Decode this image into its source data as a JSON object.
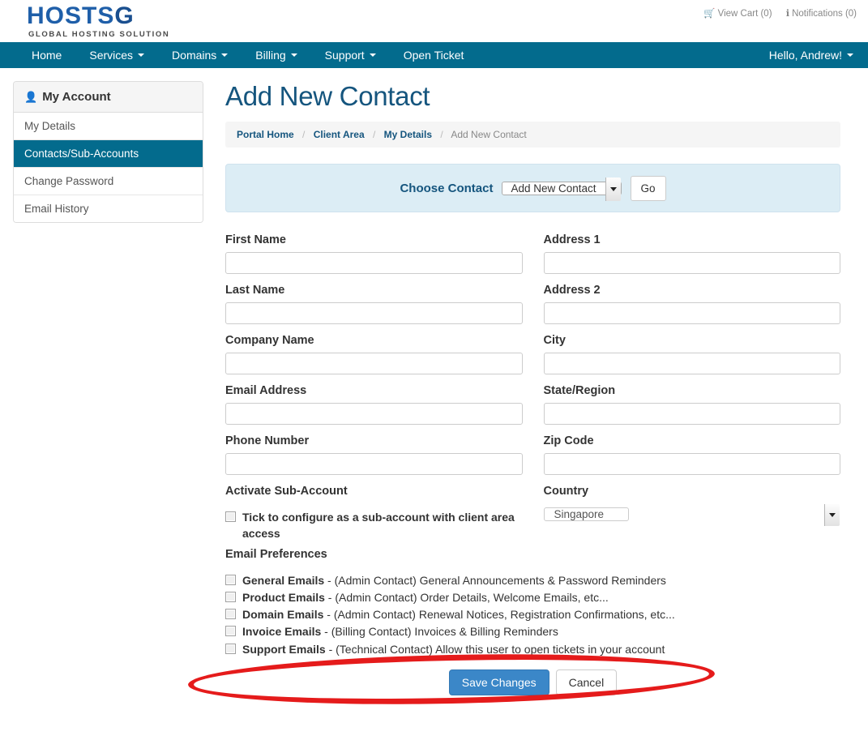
{
  "brand": {
    "logo_main": "HOSTSG",
    "logo_main_prefix": "HOSTS",
    "logo_main_accent": "G",
    "logo_sub": "GLOBAL HOSTING SOLUTION",
    "teal": "#036b8d",
    "title_blue": "#15557e",
    "primary_blue": "#3b87c8",
    "annotation_red": "#e51b1b"
  },
  "topbar": {
    "cart": "View Cart (0)",
    "cart_icon": "cart-icon",
    "notifications": "Notifications (0)",
    "notifications_icon": "info-icon"
  },
  "nav": {
    "items": [
      {
        "label": "Home",
        "has_caret": false
      },
      {
        "label": "Services",
        "has_caret": true
      },
      {
        "label": "Domains",
        "has_caret": true
      },
      {
        "label": "Billing",
        "has_caret": true
      },
      {
        "label": "Support",
        "has_caret": true
      },
      {
        "label": "Open Ticket",
        "has_caret": false
      }
    ],
    "user_greeting": "Hello, Andrew!"
  },
  "sidebar": {
    "heading": "My Account",
    "heading_icon": "user-icon",
    "items": [
      {
        "label": "My Details",
        "active": false
      },
      {
        "label": "Contacts/Sub-Accounts",
        "active": true
      },
      {
        "label": "Change Password",
        "active": false
      },
      {
        "label": "Email History",
        "active": false
      }
    ]
  },
  "main": {
    "page_title": "Add New Contact",
    "breadcrumb": [
      {
        "label": "Portal Home",
        "current": false
      },
      {
        "label": "Client Area",
        "current": false
      },
      {
        "label": "My Details",
        "current": false
      },
      {
        "label": "Add New Contact",
        "current": true
      }
    ],
    "breadcrumb_separator": "/",
    "choose_contact": {
      "label": "Choose Contact",
      "selected": "Add New Contact",
      "go_label": "Go"
    },
    "fields_left": [
      {
        "label": "First Name",
        "value": "",
        "name": "first-name"
      },
      {
        "label": "Last Name",
        "value": "",
        "name": "last-name"
      },
      {
        "label": "Company Name",
        "value": "",
        "name": "company-name"
      },
      {
        "label": "Email Address",
        "value": "",
        "name": "email-address"
      },
      {
        "label": "Phone Number",
        "value": "",
        "name": "phone-number"
      }
    ],
    "fields_right": [
      {
        "label": "Address 1",
        "value": "",
        "name": "address-1"
      },
      {
        "label": "Address 2",
        "value": "",
        "name": "address-2"
      },
      {
        "label": "City",
        "value": "",
        "name": "city"
      },
      {
        "label": "State/Region",
        "value": "",
        "name": "state-region"
      },
      {
        "label": "Zip Code",
        "value": "",
        "name": "zip-code"
      }
    ],
    "sub_account": {
      "label": "Activate Sub-Account",
      "checkbox_text": "Tick to configure as a sub-account with client area access",
      "checked": false
    },
    "country": {
      "label": "Country",
      "selected": "Singapore"
    },
    "email_preferences": {
      "label": "Email Preferences",
      "items": [
        {
          "name": "General Emails",
          "desc": " - (Admin Contact) General Announcements & Password Reminders",
          "checked": false
        },
        {
          "name": "Product Emails",
          "desc": " - (Admin Contact) Order Details, Welcome Emails, etc...",
          "checked": false
        },
        {
          "name": "Domain Emails",
          "desc": " - (Admin Contact) Renewal Notices, Registration Confirmations, etc...",
          "checked": false
        },
        {
          "name": "Invoice Emails",
          "desc": " - (Billing Contact) Invoices & Billing Reminders",
          "checked": false
        },
        {
          "name": "Support Emails",
          "desc": " - (Technical Contact) Allow this user to open tickets in your account",
          "checked": false
        }
      ]
    },
    "actions": {
      "save": "Save Changes",
      "cancel": "Cancel"
    }
  }
}
